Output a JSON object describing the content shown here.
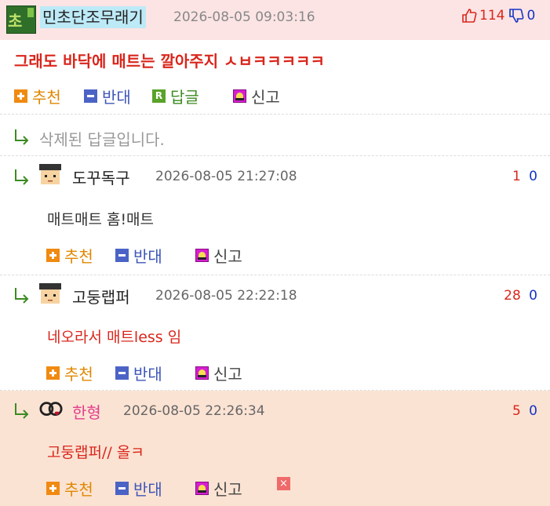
{
  "colors": {
    "red": "#d9261c",
    "blue": "#1533c4",
    "pink": "#e23d8c",
    "orange_btn": "#f08a10",
    "blue_btn": "#4c63c6",
    "green_btn": "#5aa32a",
    "header_bg": "#fce4e4",
    "highlight_bg": "#fbe3d3"
  },
  "main_post": {
    "author": "민초단조무래기",
    "avatar_text": "초",
    "date": "2026-08-05 09:03:16",
    "up_count": "114",
    "down_count": "0",
    "content": "그래도 바닥에 매트는 깔아주지 ㅅㅂㅋㅋㅋㅋㅋ",
    "actions": {
      "recommend": "추천",
      "oppose": "반대",
      "reply_icon": "R",
      "reply": "답글",
      "report": "신고"
    }
  },
  "deleted": {
    "text": "삭제된 답글입니다."
  },
  "replies": [
    {
      "author": "도꾸독구",
      "date": "2026-08-05 21:27:08",
      "up": "1",
      "down": "0",
      "content": "매트매트 홈!매트",
      "actions": {
        "recommend": "추천",
        "oppose": "반대",
        "report": "신고"
      }
    },
    {
      "author": "고둥랩퍼",
      "date": "2026-08-05 22:22:18",
      "up": "28",
      "down": "0",
      "content": "네오라서 매트less 임",
      "actions": {
        "recommend": "추천",
        "oppose": "반대",
        "report": "신고"
      }
    },
    {
      "author": "한형",
      "date": "2026-08-05 22:26:34",
      "up": "5",
      "down": "0",
      "content": "고둥랩퍼// 올ㅋ",
      "actions": {
        "recommend": "추천",
        "oppose": "반대",
        "report": "신고",
        "delete": "×"
      }
    }
  ]
}
